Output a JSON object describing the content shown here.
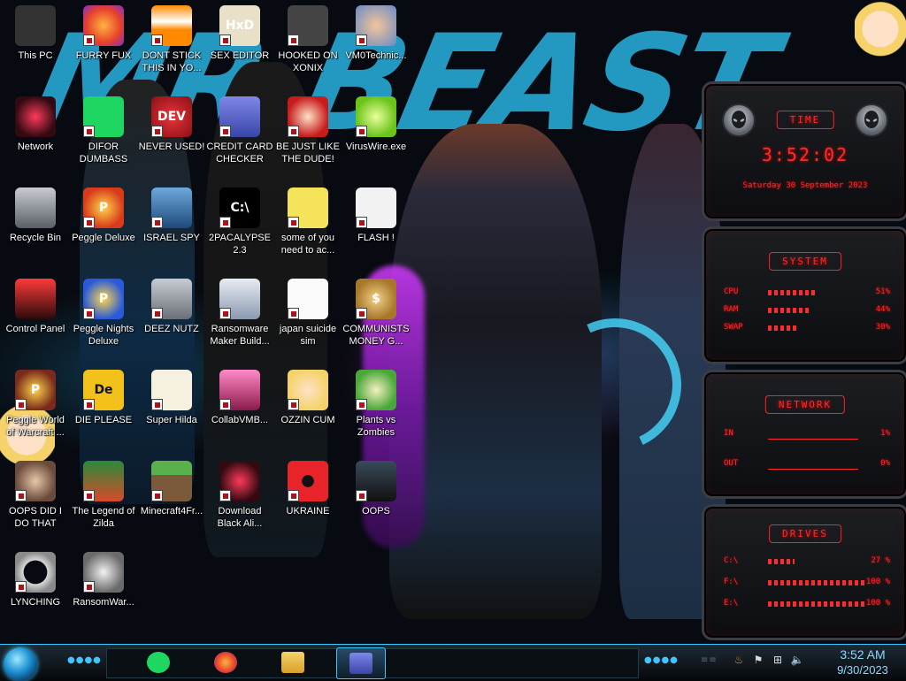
{
  "wallpaper": {
    "banner_text": "MR BEAST"
  },
  "desktop_icons": [
    {
      "label": "This PC",
      "icon": "computer-icon"
    },
    {
      "label": "FURRY FUX",
      "icon": "firefox-icon"
    },
    {
      "label": "DONT STICK THIS IN YO...",
      "icon": "vlc-cone-icon"
    },
    {
      "label": "SEX EDITOR",
      "icon": "hex-editor-icon"
    },
    {
      "label": "HOOKED ON XONIX",
      "icon": "xonix-game-icon"
    },
    {
      "label": "VM0Technic...",
      "icon": "technician-icon"
    },
    {
      "label": "Network",
      "icon": "alienware-head-icon"
    },
    {
      "label": "DIFOR DUMBASS",
      "icon": "spotify-icon"
    },
    {
      "label": "NEVER USED!",
      "icon": "dev-cpp-icon"
    },
    {
      "label": "CREDIT CARD CHECKER",
      "icon": "credit-card-icon"
    },
    {
      "label": "BE JUST LIKE THE DUDE!",
      "icon": "santa-face-icon"
    },
    {
      "label": "VirusWire.exe",
      "icon": "lime-icon"
    },
    {
      "label": "Recycle Bin",
      "icon": "recycle-bin-icon"
    },
    {
      "label": "Peggle Deluxe",
      "icon": "peggle-icon"
    },
    {
      "label": "ISRAEL SPY",
      "icon": "spy-monitor-icon"
    },
    {
      "label": "2PACALYPSE 2.3",
      "icon": "console-icon"
    },
    {
      "label": "some of you need to ac...",
      "icon": "bear-icon"
    },
    {
      "label": "FLASH !",
      "icon": "flash-document-icon"
    },
    {
      "label": "Control Panel",
      "icon": "control-panel-icon"
    },
    {
      "label": "Peggle Nights Deluxe",
      "icon": "peggle-nights-icon"
    },
    {
      "label": "DEEZ NUTZ",
      "icon": "stacked-windows-icon"
    },
    {
      "label": "Ransomware Maker Build...",
      "icon": "app-window-icon"
    },
    {
      "label": "japan suicide sim",
      "icon": "document-icon"
    },
    {
      "label": "COMMUNISTS MONEY G...",
      "icon": "money-bag-icon"
    },
    {
      "label": "Peggle World of Warcraft ...",
      "icon": "peggle-wow-icon"
    },
    {
      "label": "DIE PLEASE",
      "icon": "de-app-icon"
    },
    {
      "label": "Super Hilda",
      "icon": "pixel-cat-icon"
    },
    {
      "label": "CollabVMB...",
      "icon": "collabvm-icon"
    },
    {
      "label": "OZZIN CUM",
      "icon": "cartoon-character-icon"
    },
    {
      "label": "Plants vs Zombies",
      "icon": "plants-icon"
    },
    {
      "label": "OOPS DID I DO THAT",
      "icon": "portrait-icon"
    },
    {
      "label": "The Legend of Zilda",
      "icon": "pixel-hero-icon"
    },
    {
      "label": "Minecraft4Fr...",
      "icon": "minecraft-block-icon"
    },
    {
      "label": "Download Black Ali...",
      "icon": "alienware-head-icon"
    },
    {
      "label": "UKRAINE",
      "icon": "radiation-icon"
    },
    {
      "label": "OOPS",
      "icon": "monitor-icon"
    },
    {
      "label": "LYNCHING",
      "icon": "knot-icon"
    },
    {
      "label": "RansomWar...",
      "icon": "skull-icon"
    }
  ],
  "gadgets": {
    "time": {
      "title": "TIME",
      "clock": "3:52:02",
      "date": "Saturday 30 September 2023"
    },
    "system": {
      "title": "SYSTEM",
      "rows": [
        {
          "label": "CPU",
          "value": "51%",
          "fill": 0.51
        },
        {
          "label": "RAM",
          "value": "44%",
          "fill": 0.44
        },
        {
          "label": "SWAP",
          "value": "30%",
          "fill": 0.3
        }
      ]
    },
    "network": {
      "title": "NETWORK",
      "rows": [
        {
          "label": "IN",
          "value": "1%"
        },
        {
          "label": "OUT",
          "value": "0%"
        }
      ]
    },
    "drives": {
      "title": "DRIVES",
      "rows": [
        {
          "label": "C:\\",
          "value": "27 %",
          "fill": 0.27
        },
        {
          "label": "F:\\",
          "value": "100 %",
          "fill": 1.0
        },
        {
          "label": "E:\\",
          "value": "100 %",
          "fill": 1.0
        }
      ]
    }
  },
  "taskbar": {
    "pinned": [
      {
        "name": "spotify",
        "icon": "spotify-icon"
      },
      {
        "name": "firefox",
        "icon": "firefox-icon"
      },
      {
        "name": "file-explorer",
        "icon": "folder-icon"
      },
      {
        "name": "credit-card-checker",
        "icon": "credit-card-icon",
        "active": true
      }
    ],
    "tray": [
      {
        "icon": "java-icon"
      },
      {
        "icon": "security-flag-icon"
      },
      {
        "icon": "network-icon"
      },
      {
        "icon": "volume-icon"
      }
    ],
    "clock_time": "3:52 AM",
    "clock_date": "9/30/2023"
  },
  "colors": {
    "gadget_red": "#ff2a2a",
    "taskbar_accent": "#3ec6ff",
    "banner_blue": "#27a9d6"
  }
}
